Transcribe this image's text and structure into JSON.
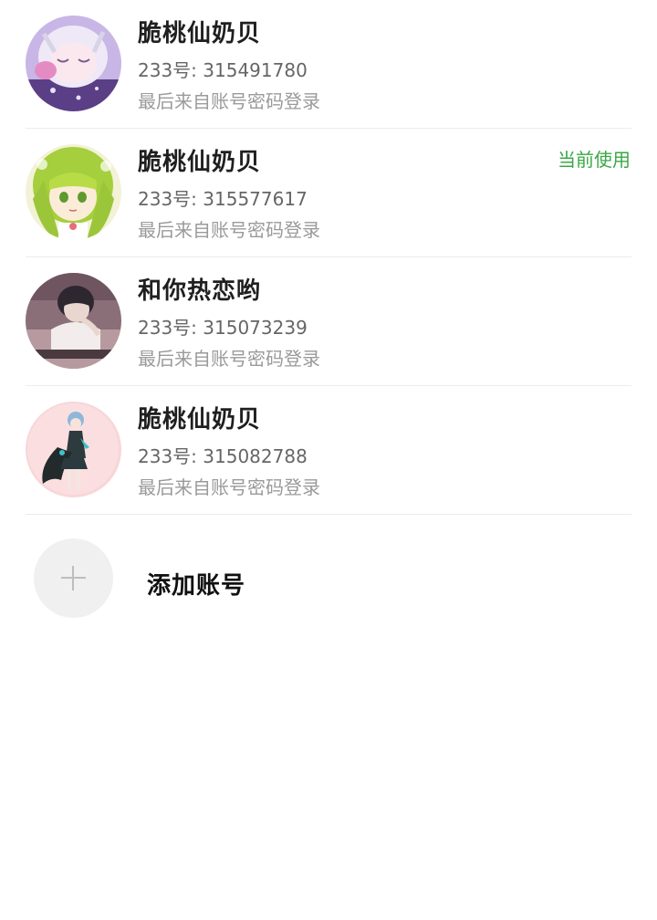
{
  "accounts": [
    {
      "nickname": "脆桃仙奶贝",
      "uid": "233号: 315491780",
      "note": "最后来自账号密码登录",
      "current": ""
    },
    {
      "nickname": "脆桃仙奶贝",
      "uid": "233号: 315577617",
      "note": "最后来自账号密码登录",
      "current": "当前使用"
    },
    {
      "nickname": "和你热恋哟",
      "uid": "233号: 315073239",
      "note": "最后来自账号密码登录",
      "current": ""
    },
    {
      "nickname": "脆桃仙奶贝",
      "uid": "233号: 315082788",
      "note": "最后来自账号密码登录",
      "current": ""
    }
  ],
  "add_account": {
    "label": "添加账号",
    "icon": "plus-icon"
  },
  "colors": {
    "current_tag": "#3aa846",
    "divider": "#ececec"
  }
}
